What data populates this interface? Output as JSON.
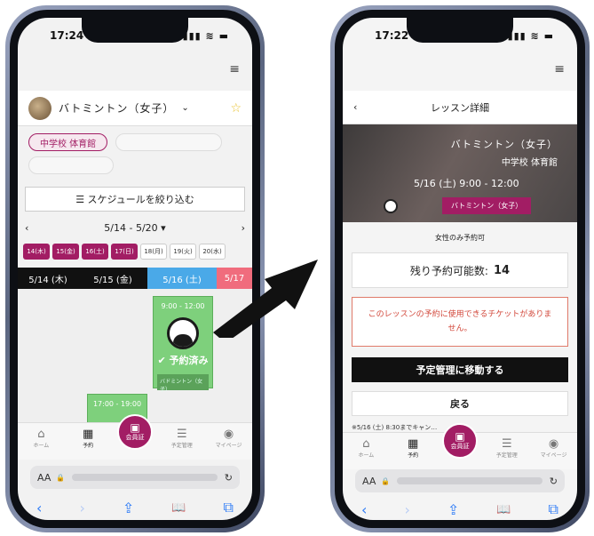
{
  "phone_left": {
    "status": {
      "time": "17:24",
      "icons": "▮▮▮ ≋ ▬"
    },
    "team": {
      "name": "バトミントン（女子）",
      "chevron": "⌄",
      "star": "☆"
    },
    "venue_chip": "中学校 体育館",
    "filter_label": "☰ スケジュールを絞り込む",
    "week": {
      "prev": "‹",
      "range": "5/14 - 5/20 ▾",
      "next": "›"
    },
    "date_chips": [
      {
        "label": "14(木)",
        "state": "on"
      },
      {
        "label": "15(金)",
        "state": "on"
      },
      {
        "label": "16(土)",
        "state": "on"
      },
      {
        "label": "17(日)",
        "state": "on"
      },
      {
        "label": "18(月)",
        "state": "off"
      },
      {
        "label": "19(火)",
        "state": "off"
      },
      {
        "label": "20(水)",
        "state": "off"
      }
    ],
    "day_headers": [
      "5/14 (木)",
      "5/15 (金)",
      "5/16 (土)",
      "5/17"
    ],
    "lessons": [
      {
        "time": "9:00 - 12:00",
        "status": "✔ 予約済み",
        "tag": "バドミントン（女子）"
      },
      {
        "time": "17:00 - 19:00"
      }
    ]
  },
  "phone_right": {
    "status": {
      "time": "17:22",
      "icons": "▮▮▮ ≋ ▬"
    },
    "header": {
      "title": "レッスン詳細",
      "back": "‹"
    },
    "hero": {
      "name": "バトミントン（女子）",
      "venue": "中学校 体育館",
      "datetime": "5/16 (土) 9:00 - 12:00",
      "badge": "バトミントン（女子）"
    },
    "women_only": "女性のみ予約可",
    "remaining_label": "残り予約可能数:",
    "remaining_value": "14",
    "warning": "このレッスンの予約に使用できるチケットがありません。",
    "primary_button": "予定管理に移動する",
    "secondary_button": "戻る",
    "note": "※5/16 (土) 8:30までキャン…"
  },
  "tabbar": [
    {
      "icon": "⌂",
      "label": "ホーム"
    },
    {
      "icon": "▦",
      "label": "予約"
    },
    {
      "icon": "",
      "label": ""
    },
    {
      "icon": "☰",
      "label": "予定管理"
    },
    {
      "icon": "◉",
      "label": "マイページ"
    }
  ],
  "member_button": {
    "icon": "▣",
    "label": "会員証"
  },
  "safari": {
    "aa": "AA",
    "lock": "🔒",
    "reload": "↻",
    "back": "‹",
    "forward": "›",
    "share": "⇪",
    "bookmarks": "📖",
    "tabs": "⧉"
  },
  "menu_icon": "≡"
}
